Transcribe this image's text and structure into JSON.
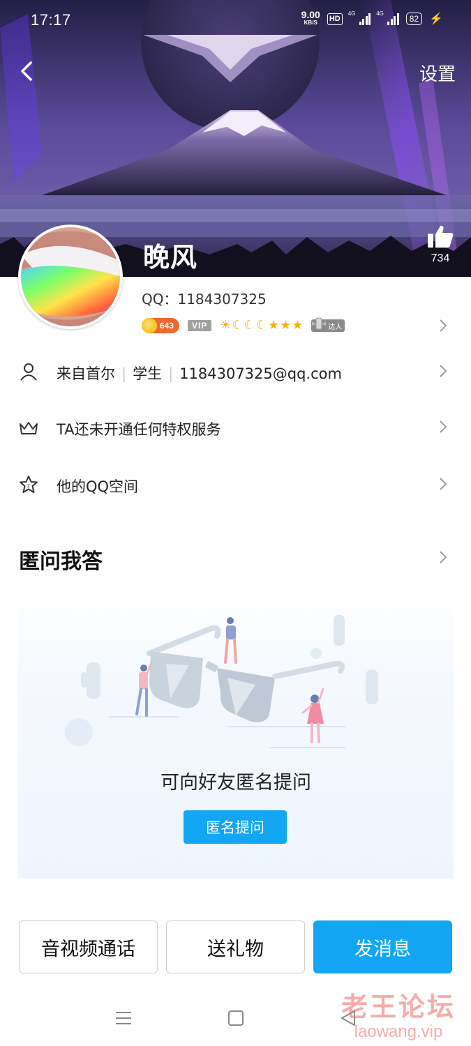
{
  "status_bar": {
    "time": "17:17",
    "net_speed_value": "9.00",
    "net_speed_unit": "KB/S",
    "hd_label": "HD",
    "signal1_label": "4G",
    "signal2_label": "4G",
    "battery": "82"
  },
  "header": {
    "back_icon": "chevron-left-icon",
    "settings_label": "设置"
  },
  "profile": {
    "nickname": "晚风",
    "qq_line": "QQ：1184307325",
    "like_count": "734",
    "coin_level": "643",
    "vip_label": "VIP",
    "level_icons": [
      "sun",
      "moon",
      "moon",
      "moon",
      "star",
      "star",
      "star"
    ],
    "expert_label": "达人"
  },
  "info_rows": {
    "location": "来自首尔",
    "occupation": "学生",
    "email": "1184307325@qq.com",
    "privilege": "TA还未开通任何特权服务",
    "qzone": "他的QQ空间"
  },
  "qa_section": {
    "title": "匿问我答",
    "prompt": "可向好友匿名提问",
    "button": "匿名提问"
  },
  "actions": {
    "call": "音视频通话",
    "gift": "送礼物",
    "message": "发消息"
  },
  "watermark": {
    "line1": "老王论坛",
    "line2": "laowang.vip"
  },
  "colors": {
    "accent": "#12a6f5",
    "coin_badge": "#f2672e",
    "star": "#f5b400"
  }
}
